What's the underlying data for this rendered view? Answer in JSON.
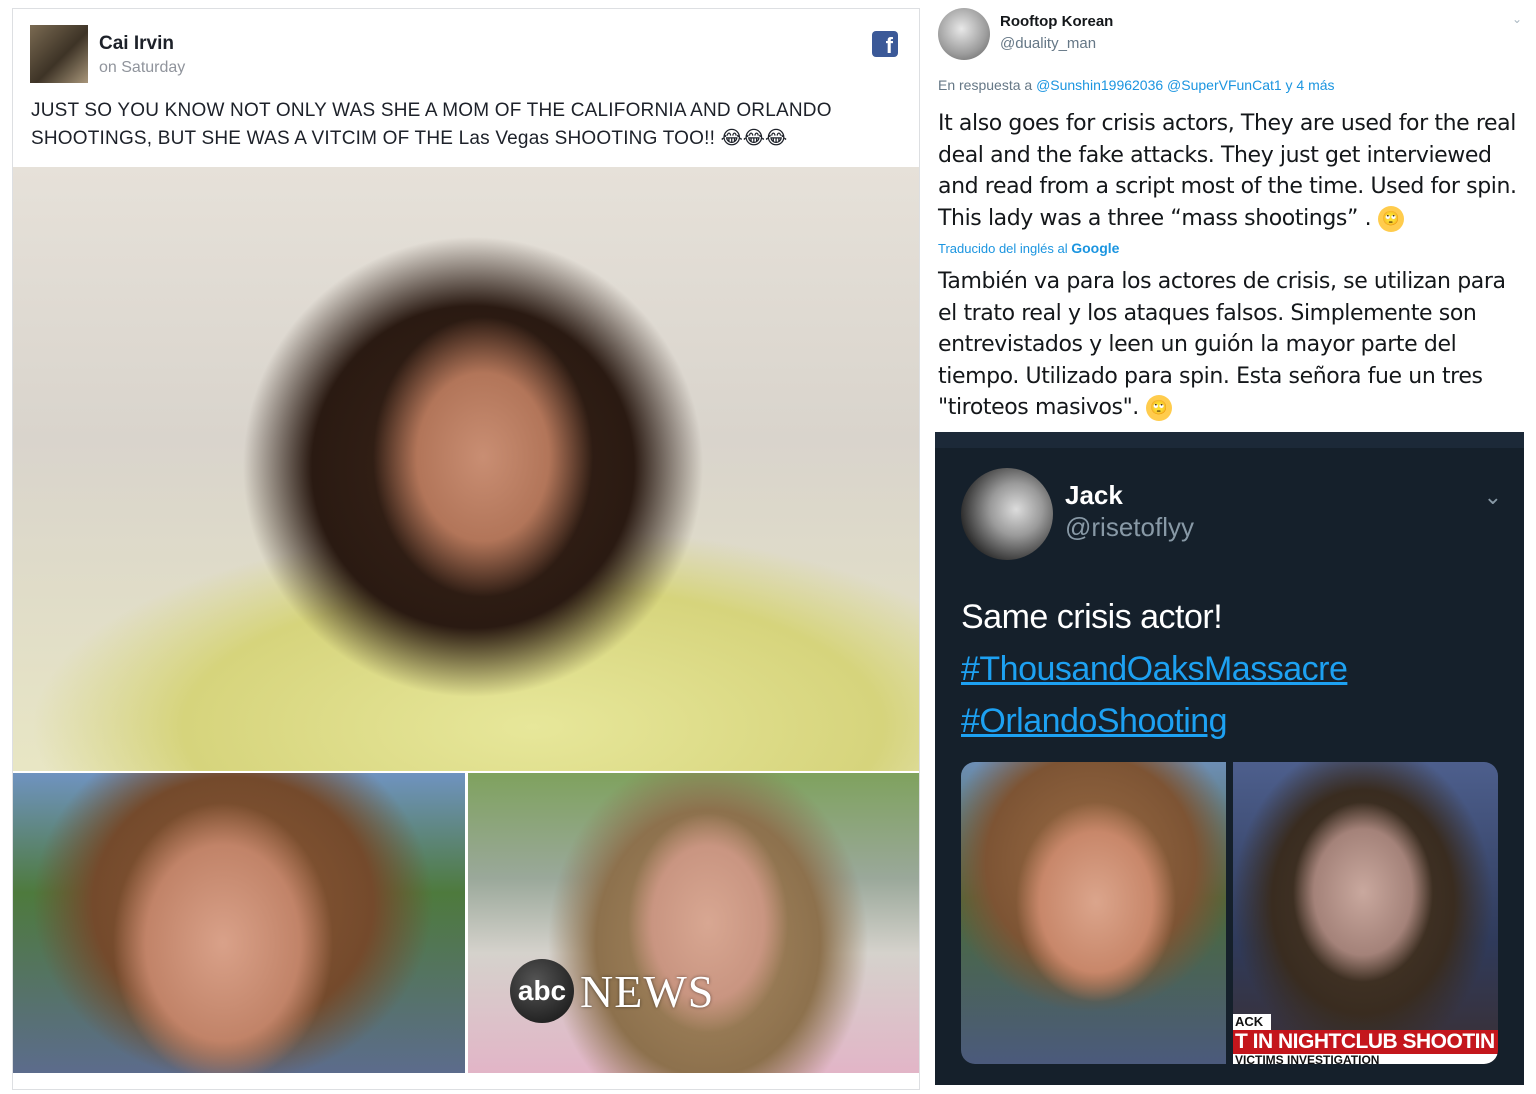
{
  "facebook_post": {
    "author": "Cai Irvin",
    "timestamp": "on Saturday",
    "logo_letter": "f",
    "text": "JUST SO YOU KNOW NOT ONLY WAS SHE A MOM OF THE CALIFORNIA AND ORLANDO SHOOTINGS, BUT SHE WAS A VITCIM OF THE Las Vegas SHOOTING TOO!!",
    "emoji": "😂😂😂",
    "abc_logo": "abc",
    "abc_news": "NEWS"
  },
  "tweet": {
    "author_name": "Rooftop Korean",
    "author_handle": "@duality_man",
    "chevron": "⌄",
    "reply_prefix": "En respuesta a ",
    "reply_mentions": "@Sunshin19962036 @SuperVFunCat1 y 4 más",
    "text": "It also goes for crisis actors, They are used for the real deal and the fake attacks. They just get interviewed and read from a script most of the time. Used for spin. This lady was a three “mass shootings” .",
    "translated_label": "Traducido del inglés al ",
    "translated_brand": "Google",
    "translation": "También va para los actores de crisis, se utilizan para el trato real y los ataques falsos. Simplemente son entrevistados y leen un guión la mayor parte del tiempo. Utilizado para spin. Esta señora fue un tres \"tiroteos masivos\".",
    "emoji_face": "🙄"
  },
  "embedded_tweet": {
    "author_name": "Jack",
    "author_handle": "@risetoflyy",
    "chevron": "⌄",
    "text": "Same crisis actor!",
    "hashtags": [
      "#ThousandOaksMassacre",
      "#OrlandoShooting"
    ],
    "cnn_tag": "ACK",
    "cnn_banner": "T IN NIGHTCLUB SHOOTIN",
    "cnn_sub": "VICTIMS   INVESTIGATION"
  },
  "colors": {
    "facebook_blue": "#3b5998",
    "twitter_blue": "#1b95e0",
    "dark_bg": "#15202b",
    "hashtag_blue": "#1da1f2",
    "cnn_red": "#c4161c"
  }
}
